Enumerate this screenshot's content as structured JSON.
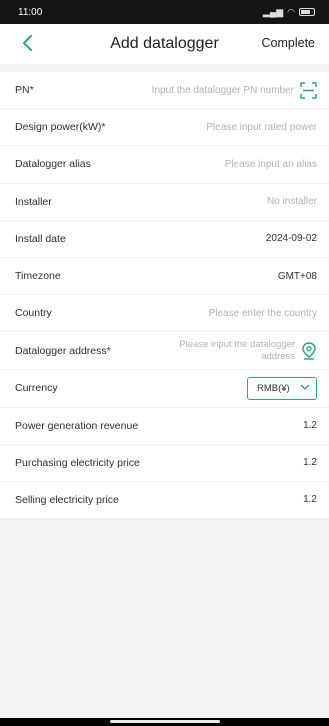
{
  "status_bar": {
    "time": "11:00",
    "signal_text": "℞░░ ░░ ≡"
  },
  "header": {
    "title": "Add datalogger",
    "complete_label": "Complete",
    "back_icon": "chevron-left-icon"
  },
  "accent_color": "#2aa57c",
  "form": {
    "pn": {
      "label": "PN*",
      "placeholder": "Input the datalogger PN number"
    },
    "design_power": {
      "label": "Design power(kW)*",
      "placeholder": "Please input rated power"
    },
    "alias": {
      "label": "Datalogger alias",
      "placeholder": "Please input an alias"
    },
    "installer": {
      "label": "Installer",
      "value": "No installer"
    },
    "install_date": {
      "label": "Install date",
      "value": "2024-09-02"
    },
    "timezone": {
      "label": "Timezone",
      "value": "GMT+08"
    },
    "country": {
      "label": "Country",
      "placeholder": "Please enter the country"
    },
    "address": {
      "label": "Datalogger address*",
      "placeholder": "Please input the datalogger address"
    },
    "currency": {
      "label": "Currency",
      "value": "RMB(¥)"
    },
    "revenue": {
      "label": "Power generation revenue",
      "value": "1.2"
    },
    "purchase_price": {
      "label": "Purchasing electricity price",
      "value": "1.2"
    },
    "selling_price": {
      "label": "Selling electricity price",
      "value": "1.2"
    }
  }
}
